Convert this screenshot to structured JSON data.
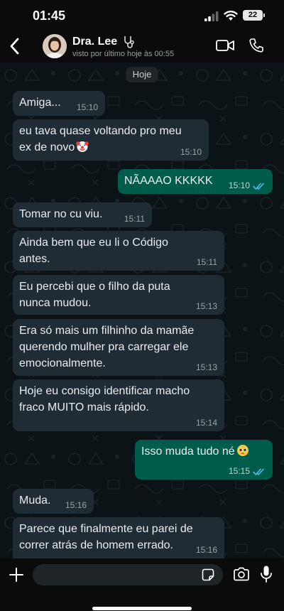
{
  "status_bar": {
    "time": "01:45",
    "battery": "22",
    "icons": [
      "signal-icon",
      "wifi-icon",
      "battery-icon"
    ]
  },
  "header": {
    "name": "Dra. Lee",
    "last_seen": "visto por último hoje às 00:55",
    "icons": [
      "back-icon",
      "stethoscope-icon",
      "video-call-icon",
      "phone-icon"
    ]
  },
  "chat": {
    "date_chip": "Hoje",
    "messages": [
      {
        "direction": "in",
        "text": "Amiga...",
        "time": "15:10"
      },
      {
        "direction": "in",
        "text": "eu tava quase voltando pro meu ex de novo",
        "emoji": "clown-face-icon",
        "time": "15:10"
      },
      {
        "direction": "out",
        "text": "NÃAAAO KKKKK",
        "time": "15:10",
        "status": "read"
      },
      {
        "direction": "in",
        "text": "Tomar no cu viu.",
        "time": "15:11"
      },
      {
        "direction": "in",
        "text": "Ainda bem que eu li o Código antes.",
        "time": "15:11"
      },
      {
        "direction": "in",
        "text": "Eu percebi que o filho da puta nunca mudou.",
        "time": "15:13"
      },
      {
        "direction": "in",
        "text": "Era só mais um filhinho da mamãe querendo mulher pra carregar ele emocionalmente.",
        "time": "15:13"
      },
      {
        "direction": "in",
        "text": "Hoje eu consigo identificar macho fraco MUITO mais rápido.",
        "time": "15:14"
      },
      {
        "direction": "out",
        "text": "Isso muda tudo né",
        "emoji": "pleading-face-icon",
        "time": "15:15",
        "status": "read"
      },
      {
        "direction": "in",
        "text": "Muda.",
        "time": "15:16"
      },
      {
        "direction": "in",
        "text": "Parece que finalmente eu parei de correr atrás de homem errado.",
        "time": "15:16"
      }
    ]
  },
  "composer": {
    "input_value": "",
    "icons": [
      "plus-icon",
      "sticker-icon",
      "camera-icon",
      "mic-icon"
    ]
  },
  "colors": {
    "incoming_bubble": "#202c33",
    "outgoing_bubble": "#005c4b",
    "read_ticks": "#53bdeb",
    "chat_background": "#0c1317"
  }
}
